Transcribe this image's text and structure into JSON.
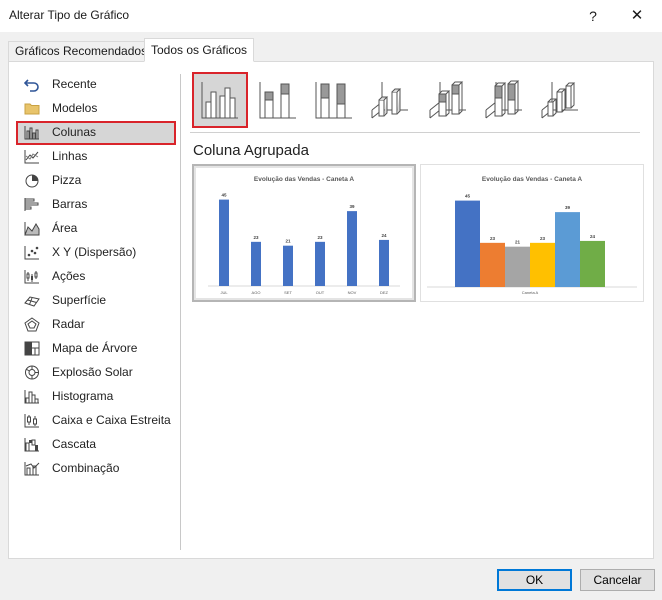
{
  "window": {
    "title": "Alterar Tipo de Gráfico",
    "help": "?",
    "close": "✕"
  },
  "tabs": [
    {
      "label": "Gráficos Recomendados"
    },
    {
      "label": "Todos os Gráficos"
    }
  ],
  "sidebar": {
    "selected": "Colunas",
    "items": [
      {
        "label": "Recente",
        "icon": "undo-icon"
      },
      {
        "label": "Modelos",
        "icon": "folder-icon"
      },
      {
        "label": "Colunas",
        "icon": "column-chart-icon"
      },
      {
        "label": "Linhas",
        "icon": "line-chart-icon"
      },
      {
        "label": "Pizza",
        "icon": "pie-chart-icon"
      },
      {
        "label": "Barras",
        "icon": "bar-chart-icon"
      },
      {
        "label": "Área",
        "icon": "area-chart-icon"
      },
      {
        "label": "X Y (Dispersão)",
        "icon": "scatter-chart-icon"
      },
      {
        "label": "Ações",
        "icon": "stock-chart-icon"
      },
      {
        "label": "Superfície",
        "icon": "surface-chart-icon"
      },
      {
        "label": "Radar",
        "icon": "radar-chart-icon"
      },
      {
        "label": "Mapa de Árvore",
        "icon": "treemap-icon"
      },
      {
        "label": "Explosão Solar",
        "icon": "sunburst-icon"
      },
      {
        "label": "Histograma",
        "icon": "histogram-icon"
      },
      {
        "label": "Caixa e Caixa Estreita",
        "icon": "box-whisker-icon"
      },
      {
        "label": "Cascata",
        "icon": "waterfall-icon"
      },
      {
        "label": "Combinação",
        "icon": "combo-chart-icon"
      }
    ]
  },
  "subtypes": {
    "selected": "Coluna Agrupada",
    "items": [
      "clustered-column-icon",
      "stacked-column-icon",
      "100-stacked-column-icon",
      "3d-clustered-column-icon",
      "3d-stacked-column-icon",
      "3d-100-stacked-column-icon",
      "3d-column-icon"
    ]
  },
  "section_heading": "Coluna Agrupada",
  "colors": {
    "preview_blue": "#4472c4",
    "series_palette": [
      "#4472c4",
      "#ed7d31",
      "#a5a5a5",
      "#ffc000",
      "#5b9bd5",
      "#70ad47"
    ],
    "selection_red": "#d9242b"
  },
  "chart_data": [
    {
      "type": "bar",
      "title": "Evolução das Vendas - Caneta A",
      "categories": [
        "JUL",
        "AGO",
        "SET",
        "OUT",
        "NOV",
        "DEZ"
      ],
      "values": [
        45,
        23,
        21,
        23,
        39,
        24
      ],
      "ylim": [
        0,
        50
      ],
      "grid": false,
      "legend": "none"
    },
    {
      "type": "bar",
      "title": "Evolução das Vendas - Caneta A",
      "categories": [
        "Caneta A"
      ],
      "series": [
        {
          "values": [
            45
          ]
        },
        {
          "values": [
            23
          ]
        },
        {
          "values": [
            21
          ]
        },
        {
          "values": [
            23
          ]
        },
        {
          "values": [
            39
          ]
        },
        {
          "values": [
            24
          ]
        }
      ],
      "ylim": [
        0,
        50
      ],
      "grid": false,
      "legend": "none"
    }
  ],
  "buttons": {
    "ok": "OK",
    "cancel": "Cancelar"
  }
}
